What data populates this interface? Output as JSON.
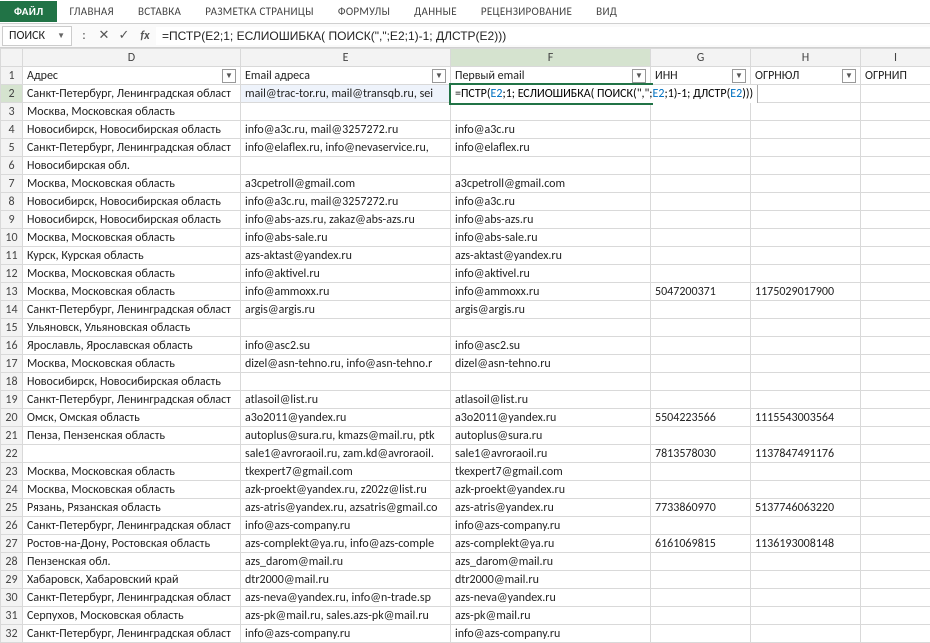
{
  "ribbon": {
    "file": "ФАЙЛ",
    "tabs": [
      "ГЛАВНАЯ",
      "ВСТАВКА",
      "РАЗМЕТКА СТРАНИЦЫ",
      "ФОРМУЛЫ",
      "ДАННЫЕ",
      "РЕЦЕНЗИРОВАНИЕ",
      "ВИД"
    ]
  },
  "formula_bar": {
    "name_box": "ПОИСК",
    "formula": "=ПСТР(E2;1; ЕСЛИОШИБКА( ПОИСК(\",\";E2;1)-1; ДЛСТР(E2)))"
  },
  "columns": [
    "D",
    "E",
    "F",
    "G",
    "H",
    "I"
  ],
  "headers": {
    "D": "Адрес",
    "E": "Email адреса",
    "F": "Первый email",
    "G": "ИНН",
    "H": "ОГРНЮЛ",
    "I": "ОГРНИП"
  },
  "editing_formula_parts": {
    "p1": "=ПСТР(",
    "p2": "E2",
    "p3": ";1; ЕСЛИОШИБКА( ПОИСК(\",\";",
    "p4": "E2",
    "p5": ";1)-1; ДЛСТР(",
    "p6": "E2",
    "p7": ")))"
  },
  "rows": [
    {
      "n": 2,
      "D": "Санкт-Петербург, Ленинградская област",
      "E": "mail@trac-tor.ru, mail@transqb.ru, sei",
      "F": "",
      "G": "",
      "H": ""
    },
    {
      "n": 3,
      "D": "Москва, Московская область",
      "E": "",
      "F": "",
      "G": "",
      "H": ""
    },
    {
      "n": 4,
      "D": "Новосибирск, Новосибирская область",
      "E": "info@a3c.ru, mail@3257272.ru",
      "F": "info@a3c.ru",
      "G": "",
      "H": ""
    },
    {
      "n": 5,
      "D": "Санкт-Петербург, Ленинградская област",
      "E": "info@elaflex.ru, info@nevaservice.ru,",
      "F": "info@elaflex.ru",
      "G": "",
      "H": ""
    },
    {
      "n": 6,
      "D": "Новосибирская обл.",
      "E": "",
      "F": "",
      "G": "",
      "H": ""
    },
    {
      "n": 7,
      "D": "Москва, Московская область",
      "E": "a3cpetroll@gmail.com",
      "F": "a3cpetroll@gmail.com",
      "G": "",
      "H": ""
    },
    {
      "n": 8,
      "D": "Новосибирск, Новосибирская область",
      "E": "info@a3c.ru, mail@3257272.ru",
      "F": "info@a3c.ru",
      "G": "",
      "H": ""
    },
    {
      "n": 9,
      "D": "Новосибирск, Новосибирская область",
      "E": "info@abs-azs.ru, zakaz@abs-azs.ru",
      "F": "info@abs-azs.ru",
      "G": "",
      "H": ""
    },
    {
      "n": 10,
      "D": "Москва, Московская область",
      "E": "info@abs-sale.ru",
      "F": "info@abs-sale.ru",
      "G": "",
      "H": ""
    },
    {
      "n": 11,
      "D": "Курск, Курская область",
      "E": "azs-aktast@yandex.ru",
      "F": "azs-aktast@yandex.ru",
      "G": "",
      "H": ""
    },
    {
      "n": 12,
      "D": "Москва, Московская область",
      "E": "info@aktivel.ru",
      "F": "info@aktivel.ru",
      "G": "",
      "H": ""
    },
    {
      "n": 13,
      "D": "Москва, Московская область",
      "E": "info@ammoxx.ru",
      "F": "info@ammoxx.ru",
      "G": "5047200371",
      "H": "1175029017900"
    },
    {
      "n": 14,
      "D": "Санкт-Петербург, Ленинградская област",
      "E": "argis@argis.ru",
      "F": "argis@argis.ru",
      "G": "",
      "H": ""
    },
    {
      "n": 15,
      "D": "Ульяновск, Ульяновская область",
      "E": "",
      "F": "",
      "G": "",
      "H": ""
    },
    {
      "n": 16,
      "D": "Ярославль, Ярославская область",
      "E": "info@asc2.su",
      "F": "info@asc2.su",
      "G": "",
      "H": ""
    },
    {
      "n": 17,
      "D": "Москва, Московская область",
      "E": "dizel@asn-tehno.ru, info@asn-tehno.r",
      "F": "dizel@asn-tehno.ru",
      "G": "",
      "H": ""
    },
    {
      "n": 18,
      "D": "Новосибирск, Новосибирская область",
      "E": "",
      "F": "",
      "G": "",
      "H": ""
    },
    {
      "n": 19,
      "D": "Санкт-Петербург, Ленинградская област",
      "E": "atlasoil@list.ru",
      "F": "atlasoil@list.ru",
      "G": "",
      "H": ""
    },
    {
      "n": 20,
      "D": "Омск, Омская область",
      "E": "a3o2011@yandex.ru",
      "F": "a3o2011@yandex.ru",
      "G": "5504223566",
      "H": "1115543003564"
    },
    {
      "n": 21,
      "D": "Пенза, Пензенская область",
      "E": "autoplus@sura.ru, kmazs@mail.ru, ptk",
      "F": "autoplus@sura.ru",
      "G": "",
      "H": ""
    },
    {
      "n": 22,
      "D": "",
      "E": "sale1@avroraoil.ru, zam.kd@avroraoil.",
      "F": "sale1@avroraoil.ru",
      "G": "7813578030",
      "H": "1137847491176"
    },
    {
      "n": 23,
      "D": "Москва, Московская область",
      "E": "tkexpert7@gmail.com",
      "F": "tkexpert7@gmail.com",
      "G": "",
      "H": ""
    },
    {
      "n": 24,
      "D": "Москва, Московская область",
      "E": "azk-proekt@yandex.ru, z202z@list.ru",
      "F": "azk-proekt@yandex.ru",
      "G": "",
      "H": ""
    },
    {
      "n": 25,
      "D": "Рязань, Рязанская область",
      "E": "azs-atris@yandex.ru, azsatris@gmail.co",
      "F": "azs-atris@yandex.ru",
      "G": "7733860970",
      "H": "5137746063220"
    },
    {
      "n": 26,
      "D": "Санкт-Петербург, Ленинградская област",
      "E": "info@azs-company.ru",
      "F": "info@azs-company.ru",
      "G": "",
      "H": ""
    },
    {
      "n": 27,
      "D": "Ростов-на-Дону, Ростовская область",
      "E": "azs-complekt@ya.ru, info@azs-comple",
      "F": "azs-complekt@ya.ru",
      "G": "6161069815",
      "H": "1136193008148"
    },
    {
      "n": 28,
      "D": "Пензенская обл.",
      "E": "azs_darom@mail.ru",
      "F": "azs_darom@mail.ru",
      "G": "",
      "H": ""
    },
    {
      "n": 29,
      "D": "Хабаровск, Хабаровский край",
      "E": "dtr2000@mail.ru",
      "F": "dtr2000@mail.ru",
      "G": "",
      "H": ""
    },
    {
      "n": 30,
      "D": "Санкт-Петербург, Ленинградская област",
      "E": "azs-neva@yandex.ru, info@n-trade.sp",
      "F": "azs-neva@yandex.ru",
      "G": "",
      "H": ""
    },
    {
      "n": 31,
      "D": "Серпухов, Московская область",
      "E": "azs-pk@mail.ru, sales.azs-pk@mail.ru",
      "F": "azs-pk@mail.ru",
      "G": "",
      "H": ""
    },
    {
      "n": 32,
      "D": "Санкт-Петербург, Ленинградская област",
      "E": "info@azs-company.ru",
      "F": "info@azs-company.ru",
      "G": "",
      "H": ""
    }
  ]
}
